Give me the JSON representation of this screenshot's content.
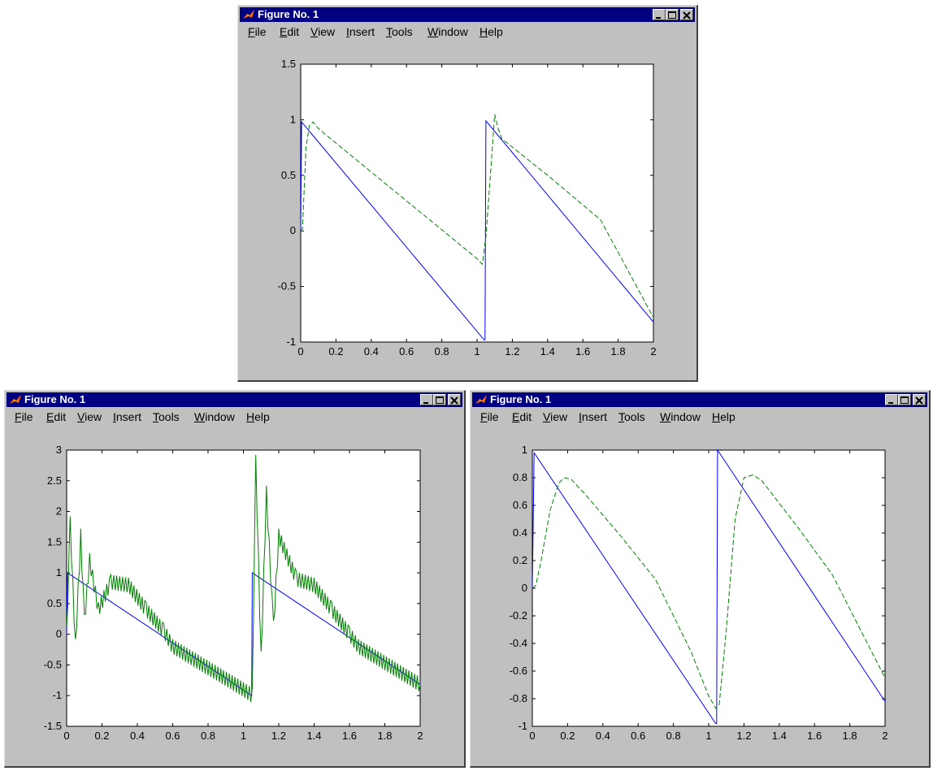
{
  "windows": [
    {
      "id": "fig-top",
      "title": "Figure No. 1",
      "menu": [
        "File",
        "Edit",
        "View",
        "Insert",
        "Tools",
        "Window",
        "Help"
      ],
      "chart_data": {
        "type": "line",
        "xlim": [
          0,
          2
        ],
        "ylim": [
          -1,
          1.5
        ],
        "xticks": [
          "0",
          "0.2",
          "0.4",
          "0.6",
          "0.8",
          "1",
          "1.2",
          "1.4",
          "1.6",
          "1.8",
          "2"
        ],
        "yticks": [
          "-1",
          "-0.5",
          "0",
          "0.5",
          "1",
          "1.5"
        ],
        "series": [
          {
            "color": "#0000ff",
            "style": "solid",
            "points": [
              [
                0,
                0
              ],
              [
                0.005,
                0.98
              ],
              [
                1.04,
                -0.98
              ],
              [
                1.045,
                -0.98
              ],
              [
                1.05,
                0.99
              ],
              [
                2,
                -0.82
              ]
            ]
          },
          {
            "color": "#008000",
            "style": "dashed",
            "points": [
              [
                0,
                0
              ],
              [
                0.01,
                0.02
              ],
              [
                0.03,
                0.75
              ],
              [
                0.05,
                0.95
              ],
              [
                0.07,
                0.98
              ],
              [
                0.1,
                0.92
              ],
              [
                0.3,
                0.66
              ],
              [
                0.5,
                0.4
              ],
              [
                0.7,
                0.14
              ],
              [
                0.9,
                -0.12
              ],
              [
                1.0,
                -0.25
              ],
              [
                1.03,
                -0.3
              ],
              [
                1.05,
                -0.05
              ],
              [
                1.08,
                0.6
              ],
              [
                1.1,
                1.05
              ],
              [
                1.12,
                0.92
              ],
              [
                1.14,
                0.83
              ],
              [
                1.4,
                0.5
              ],
              [
                1.7,
                0.1
              ],
              [
                2,
                -0.78
              ]
            ]
          }
        ]
      }
    },
    {
      "id": "fig-left",
      "title": "Figure No. 1",
      "menu": [
        "File",
        "Edit",
        "View",
        "Insert",
        "Tools",
        "Window",
        "Help"
      ],
      "chart_data": {
        "type": "line",
        "xlim": [
          0,
          2
        ],
        "ylim": [
          -1.5,
          3
        ],
        "xticks": [
          "0",
          "0.2",
          "0.4",
          "0.6",
          "0.8",
          "1",
          "1.2",
          "1.4",
          "1.6",
          "1.8",
          "2"
        ],
        "yticks": [
          "-1.5",
          "-1",
          "-0.5",
          "0",
          "0.5",
          "1",
          "1.5",
          "2",
          "2.5",
          "3"
        ],
        "series": [
          {
            "color": "#0000ff",
            "style": "solid",
            "points": [
              [
                0,
                0
              ],
              [
                0.005,
                1.0
              ],
              [
                1.047,
                -1.0
              ],
              [
                1.05,
                1.0
              ],
              [
                2,
                -0.82
              ]
            ]
          },
          {
            "color": "#008000",
            "style": "oscillating",
            "points": [
              [
                0,
                0
              ],
              [
                0.02,
                1.8
              ],
              [
                0.05,
                -0.2
              ],
              [
                0.08,
                1.6
              ],
              [
                0.1,
                0.2
              ],
              [
                0.13,
                1.2
              ],
              [
                0.18,
                0.4
              ],
              [
                0.25,
                0.85
              ],
              [
                0.35,
                0.8
              ],
              [
                0.45,
                0.4
              ],
              [
                0.55,
                0.05
              ],
              [
                0.6,
                -0.2
              ],
              [
                1.0,
                -0.9
              ],
              [
                1.05,
                -1.0
              ],
              [
                1.07,
                2.8
              ],
              [
                1.1,
                -0.4
              ],
              [
                1.13,
                2.3
              ],
              [
                1.17,
                0.1
              ],
              [
                1.2,
                1.6
              ],
              [
                1.3,
                0.9
              ],
              [
                1.4,
                0.8
              ],
              [
                1.5,
                0.4
              ],
              [
                1.6,
                0.0
              ],
              [
                1.65,
                -0.2
              ],
              [
                2,
                -0.82
              ]
            ]
          }
        ]
      }
    },
    {
      "id": "fig-right",
      "title": "Figure No. 1",
      "menu": [
        "File",
        "Edit",
        "View",
        "Insert",
        "Tools",
        "Window",
        "Help"
      ],
      "chart_data": {
        "type": "line",
        "xlim": [
          0,
          2
        ],
        "ylim": [
          -1,
          1
        ],
        "xticks": [
          "0",
          "0.2",
          "0.4",
          "0.6",
          "0.8",
          "1",
          "1.2",
          "1.4",
          "1.6",
          "1.8",
          "2"
        ],
        "yticks": [
          "-1",
          "-0.8",
          "-0.6",
          "-0.4",
          "-0.2",
          "0",
          "0.2",
          "0.4",
          "0.6",
          "0.8",
          "1"
        ],
        "series": [
          {
            "color": "#0000ff",
            "style": "solid",
            "points": [
              [
                0,
                0
              ],
              [
                0.01,
                0.98
              ],
              [
                1.04,
                -0.98
              ],
              [
                1.045,
                -0.98
              ],
              [
                1.05,
                1.0
              ],
              [
                2,
                -0.82
              ]
            ]
          },
          {
            "color": "#008000",
            "style": "dashed",
            "points": [
              [
                0,
                0
              ],
              [
                0.02,
                0.02
              ],
              [
                0.05,
                0.2
              ],
              [
                0.1,
                0.56
              ],
              [
                0.15,
                0.76
              ],
              [
                0.18,
                0.8
              ],
              [
                0.22,
                0.79
              ],
              [
                0.3,
                0.68
              ],
              [
                0.5,
                0.38
              ],
              [
                0.7,
                0.06
              ],
              [
                0.9,
                -0.46
              ],
              [
                1.0,
                -0.78
              ],
              [
                1.04,
                -0.87
              ],
              [
                1.06,
                -0.84
              ],
              [
                1.1,
                -0.3
              ],
              [
                1.15,
                0.5
              ],
              [
                1.2,
                0.8
              ],
              [
                1.25,
                0.82
              ],
              [
                1.3,
                0.78
              ],
              [
                1.5,
                0.45
              ],
              [
                1.7,
                0.1
              ],
              [
                1.9,
                -0.4
              ],
              [
                2,
                -0.65
              ]
            ]
          }
        ]
      }
    }
  ]
}
